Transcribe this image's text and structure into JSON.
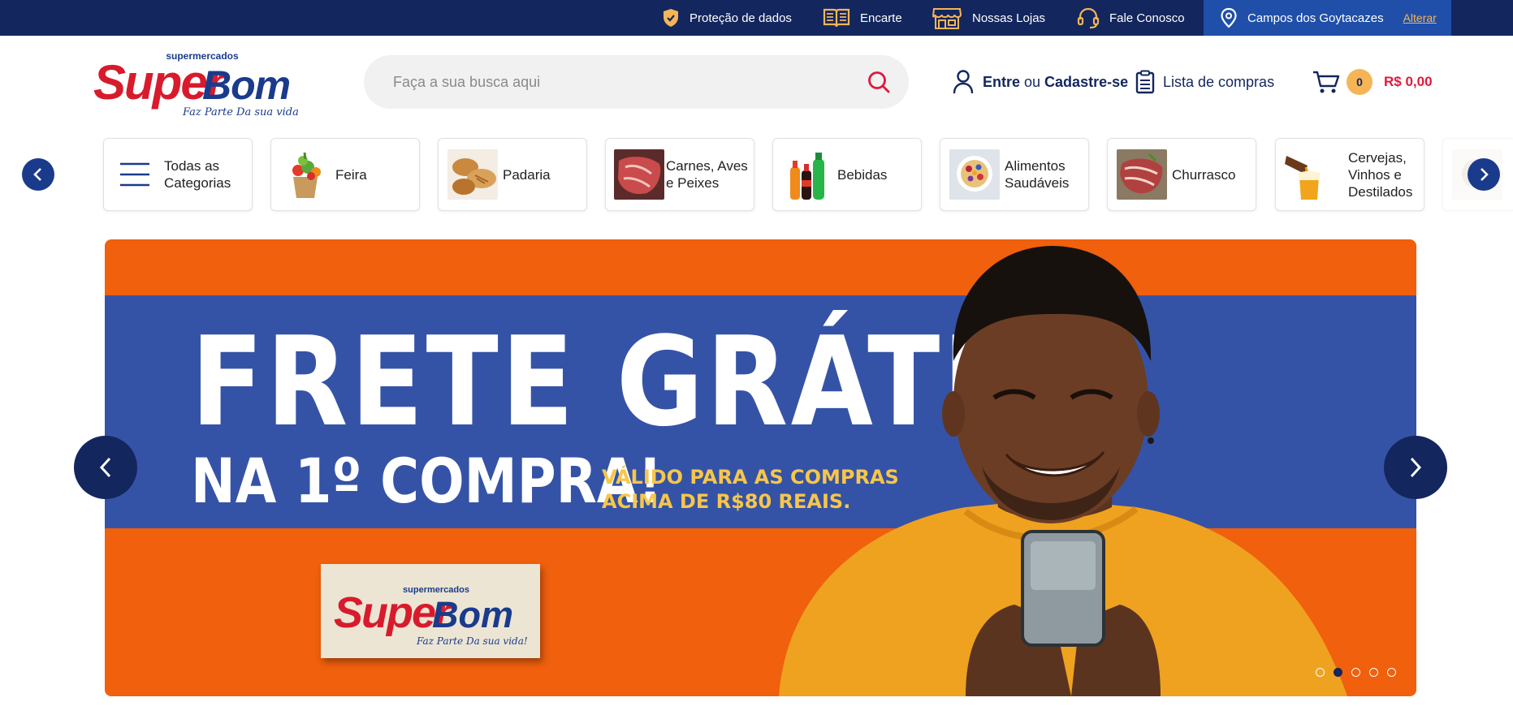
{
  "topbar": {
    "items": [
      {
        "label": "Proteção de dados",
        "icon": "shield-check-icon"
      },
      {
        "label": "Encarte",
        "icon": "open-book-icon"
      },
      {
        "label": "Nossas Lojas",
        "icon": "store-icon"
      },
      {
        "label": "Fale Conosco",
        "icon": "headset-icon"
      }
    ],
    "location": {
      "city": "Campos dos Goytacazes",
      "change_label": "Alterar",
      "icon": "map-pin-icon"
    }
  },
  "logo": {
    "top_text": "supermercados",
    "brand_super": "Super",
    "brand_bom": "Bom",
    "tagline": "Faz Parte Da sua vida!"
  },
  "search": {
    "placeholder": "Faça a sua busca aqui",
    "icon": "search-icon"
  },
  "account": {
    "login_label": "Entre",
    "or_label": "ou",
    "register_label": "Cadastre-se",
    "icon": "user-icon"
  },
  "shopping_list": {
    "label": "Lista de compras",
    "icon": "clipboard-list-icon"
  },
  "cart": {
    "count": "0",
    "total": "R$ 0,00",
    "icon": "cart-icon"
  },
  "categories": [
    {
      "label": "Todas as Categorias",
      "icon": "hamburger-menu-icon"
    },
    {
      "label": "Feira"
    },
    {
      "label": "Padaria"
    },
    {
      "label": "Carnes, Aves e Peixes"
    },
    {
      "label": "Bebidas"
    },
    {
      "label": "Alimentos Saudáveis"
    },
    {
      "label": "Churrasco"
    },
    {
      "label": "Cervejas, Vinhos e Destilados"
    }
  ],
  "banner": {
    "headline_1": "FRETE GRÁTIS",
    "headline_2": "NA 1º COMPRA!",
    "validity_line1": "VÁLIDO PARA AS COMPRAS",
    "validity_line2": "ACIMA DE R$80 REAIS.",
    "slide_count": 5,
    "active_slide": 2
  },
  "colors": {
    "navy": "#13265e",
    "blue": "#1f4fa8",
    "banner_orange": "#f0600d",
    "banner_blue": "#3553a6",
    "accent_yellow": "#f5b557",
    "price_red": "#e0193c"
  }
}
